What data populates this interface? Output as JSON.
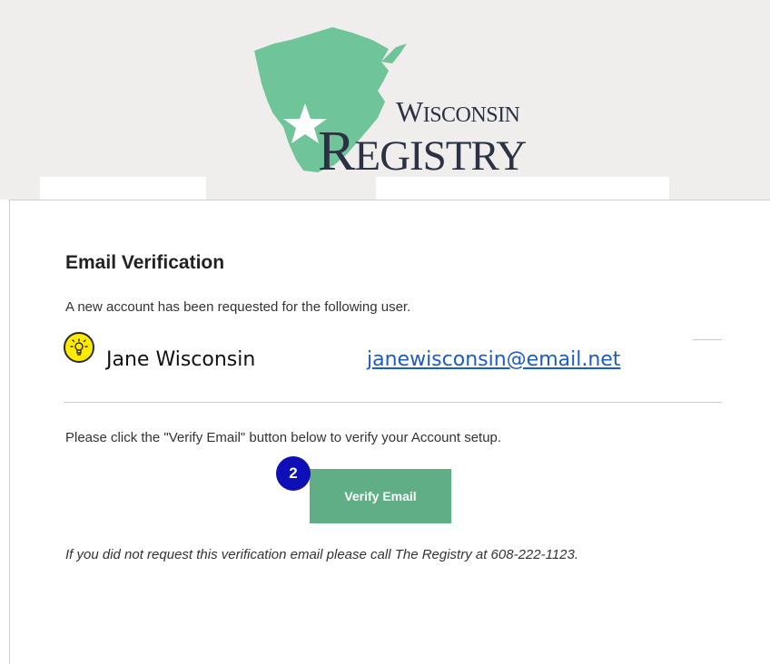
{
  "logo": {
    "text": "WISCONSIN REGISTRY",
    "word1_first": "W",
    "word1_rest": "ISCONSIN",
    "word2_first": "R",
    "word2_rest": "EGISTRY",
    "colors": {
      "map": "#6fc49a",
      "text": "#2c3244"
    }
  },
  "card": {
    "title": "Email Verification",
    "intro": "A new account has been requested for the following user.",
    "user_name": "Jane Wisconsin",
    "user_email": "janewisconsin@email.net",
    "instruction": "Please click the \"Verify Email\" button below to verify your Account setup.",
    "verify_label": "Verify Email",
    "step_badge": "2",
    "footer_note": "If you did not request this verification email please call The Registry at 608-222-1123."
  },
  "icons": {
    "tip": "lightbulb-icon"
  },
  "colors": {
    "button": "#5fae86",
    "badge": "#0f0fb8",
    "tip": "#ffeb00",
    "link": "#1f5bc6"
  }
}
